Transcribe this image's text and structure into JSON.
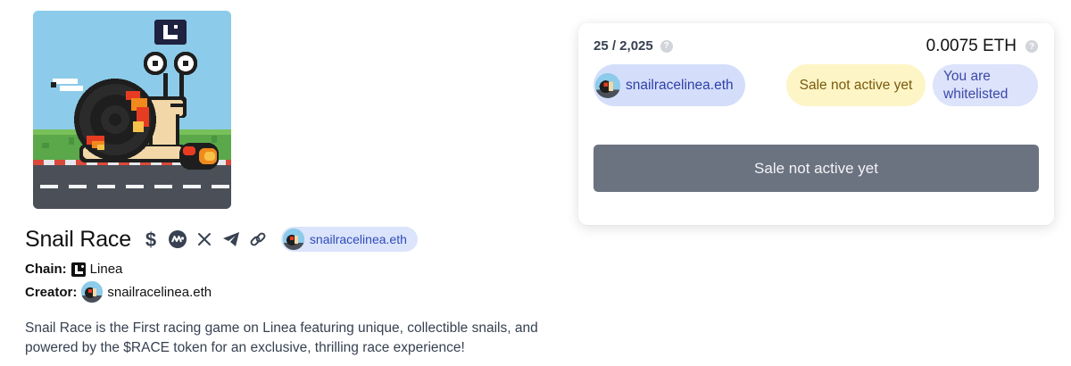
{
  "collection": {
    "title": "Snail Race",
    "chain_label": "Chain:",
    "chain_value": "Linea",
    "creator_label": "Creator:",
    "creator_name": "snailracelinea.eth",
    "description": "Snail Race is the First racing game on Linea featuring unique, collectible snails, and powered by the $RACE token for an exclusive, thrilling race experience!",
    "creator_chip": "snailracelinea.eth",
    "social_icons": [
      "dollar-icon",
      "coinmarketcap-icon",
      "x-icon",
      "telegram-icon",
      "link-icon"
    ]
  },
  "mint_card": {
    "supply": "25 / 2,025",
    "price": "0.0075 ETH",
    "creator_pill": "snailracelinea.eth",
    "status_pill": "Sale not active yet",
    "whitelist_line1": "You are",
    "whitelist_line2": "whitelisted",
    "help_symbol": "?",
    "button_label": "Sale not active yet"
  },
  "colors": {
    "chip_bg": "#dbe4fb",
    "chip_text": "#2f4bb8",
    "status_bg": "#fdf5c5",
    "status_text": "#7a5a0f",
    "button_bg": "#6b7280"
  }
}
